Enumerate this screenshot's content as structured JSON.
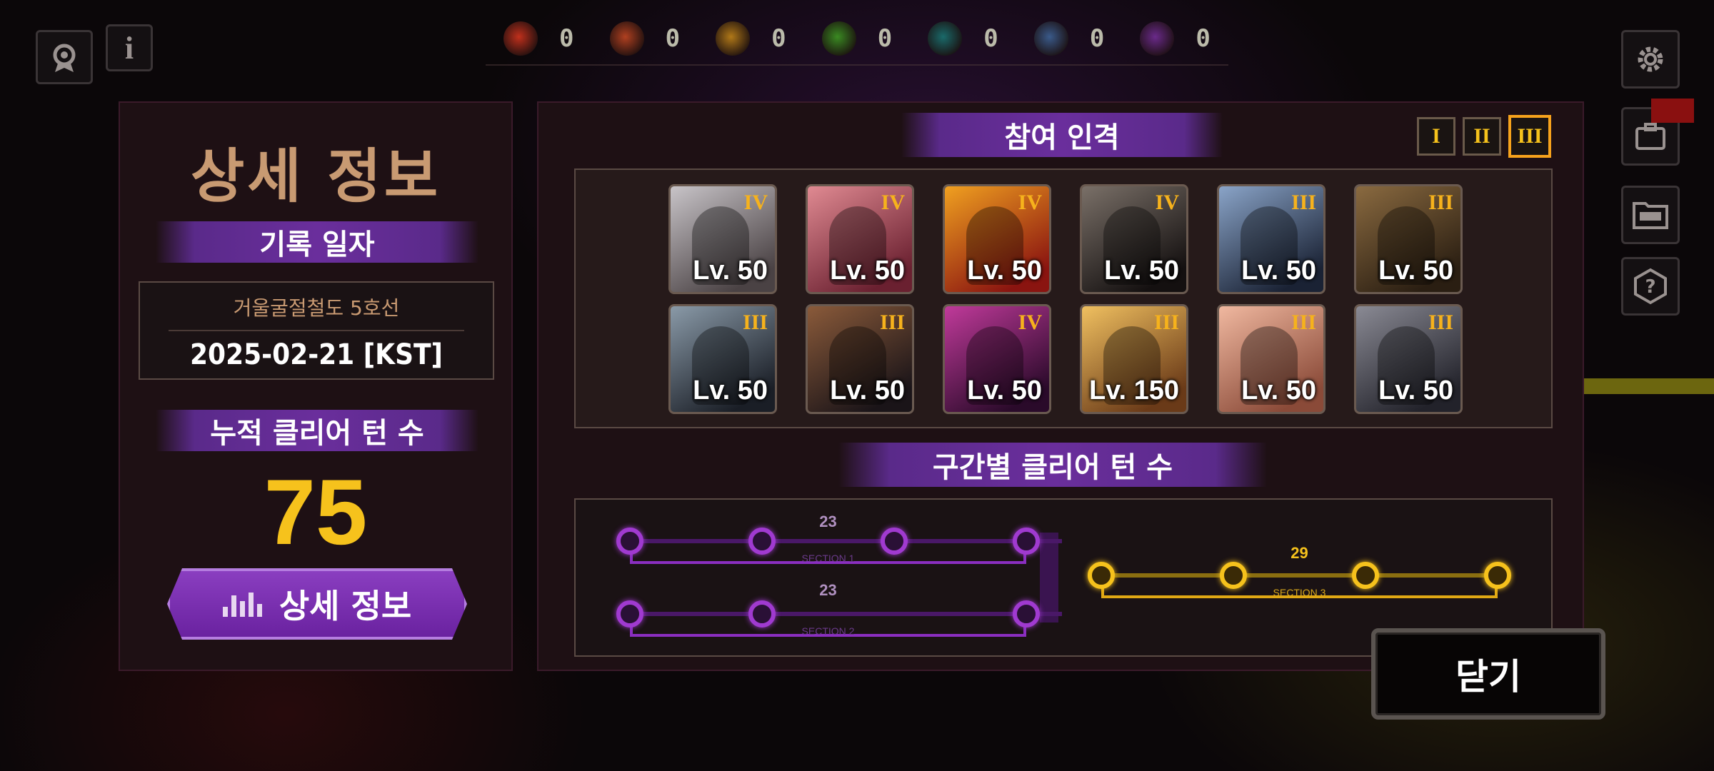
{
  "resources": [
    {
      "icon": "fire-element-icon",
      "color": "#c0301c",
      "count": "0"
    },
    {
      "icon": "thorn-element-icon",
      "color": "#b04020",
      "count": "0"
    },
    {
      "icon": "amber-element-icon",
      "color": "#b07818",
      "count": "0"
    },
    {
      "icon": "leaf-element-icon",
      "color": "#3a8a22",
      "count": "0"
    },
    {
      "icon": "wave-element-icon",
      "color": "#1a6a6a",
      "count": "0"
    },
    {
      "icon": "crystal-element-icon",
      "color": "#3a5a8a",
      "count": "0"
    },
    {
      "icon": "void-element-icon",
      "color": "#6a2a8a",
      "count": "0"
    }
  ],
  "left": {
    "title": "상세 정보",
    "record_date_label": "기록 일자",
    "location": "거울굴절철도 5호선",
    "date": "2025-02-21 [KST]",
    "total_turns_label": "누적 클리어 턴 수",
    "total_turns": "75",
    "detail_button": "상세 정보"
  },
  "roster": {
    "title": "참여 인격",
    "tiers": [
      "I",
      "II",
      "III"
    ],
    "selected_tier": "III",
    "cards": [
      {
        "tier": "IV",
        "level": "Lv. 50",
        "colors": [
          "#c8c4c8",
          "#4a4244"
        ]
      },
      {
        "tier": "IV",
        "level": "Lv. 50",
        "colors": [
          "#e08a92",
          "#6a2030"
        ]
      },
      {
        "tier": "IV",
        "level": "Lv. 50",
        "colors": [
          "#f0a020",
          "#8a1410"
        ]
      },
      {
        "tier": "IV",
        "level": "Lv. 50",
        "colors": [
          "#7a7068",
          "#141010"
        ]
      },
      {
        "tier": "III",
        "level": "Lv. 50",
        "colors": [
          "#8aa4c8",
          "#1a2234"
        ]
      },
      {
        "tier": "III",
        "level": "Lv. 50",
        "colors": [
          "#8a6a40",
          "#2a1e12"
        ]
      },
      {
        "tier": "III",
        "level": "Lv. 50",
        "colors": [
          "#8a9aa8",
          "#1a1e26"
        ]
      },
      {
        "tier": "III",
        "level": "Lv. 50",
        "colors": [
          "#8a5a3a",
          "#1a1418"
        ]
      },
      {
        "tier": "IV",
        "level": "Lv. 50",
        "colors": [
          "#c03a9a",
          "#2a0a2a"
        ]
      },
      {
        "tier": "III",
        "level": "Lv. 150",
        "colors": [
          "#f0c060",
          "#6a3a18"
        ]
      },
      {
        "tier": "III",
        "level": "Lv. 50",
        "colors": [
          "#f0b8a0",
          "#8a4a38"
        ]
      },
      {
        "tier": "III",
        "level": "Lv. 50",
        "colors": [
          "#8a8a94",
          "#22222a"
        ]
      }
    ]
  },
  "sections": {
    "title": "구간별 클리어 턴 수",
    "items": [
      {
        "name": "SECTION 1",
        "turns": "23",
        "nodes": 4
      },
      {
        "name": "SECTION 2",
        "turns": "23",
        "nodes": 3
      },
      {
        "name": "SECTION 3",
        "turns": "29",
        "nodes": 4
      }
    ]
  },
  "close_button": "닫기"
}
